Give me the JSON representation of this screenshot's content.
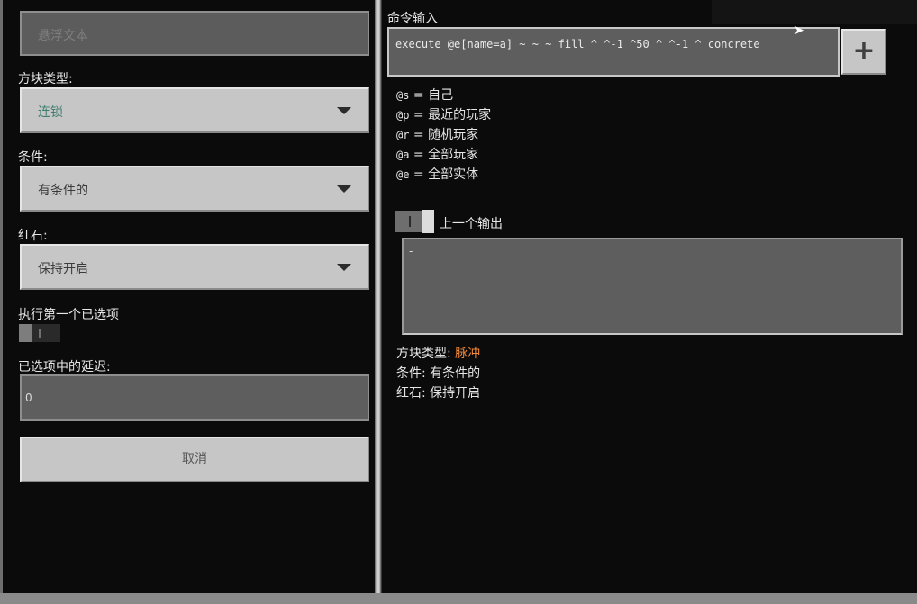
{
  "left_panel": {
    "hover_text_placeholder": "悬浮文本",
    "block_type_label": "方块类型:",
    "block_type_value": "连锁",
    "condition_label": "条件:",
    "condition_value": "有条件的",
    "redstone_label": "红石:",
    "redstone_value": "保持开启",
    "execute_first_label": "执行第一个已选项",
    "delay_label": "已选项中的延迟:",
    "delay_value": "0",
    "cancel_label": "取消"
  },
  "right_panel": {
    "command_input_label": "命令输入",
    "command_value": "execute @e[name=a] ~ ~ ~ fill ^ ^-1 ^50 ^ ^-1 ^ concrete",
    "add_button_label": "+",
    "selectors": [
      {
        "code": "@s",
        "desc": "= 自己"
      },
      {
        "code": "@p",
        "desc": "= 最近的玩家"
      },
      {
        "code": "@r",
        "desc": "= 随机玩家"
      },
      {
        "code": "@a",
        "desc": "= 全部玩家"
      },
      {
        "code": "@e",
        "desc": "= 全部实体"
      }
    ],
    "previous_output_label": "上一个输出",
    "output_value": "-",
    "info": {
      "block_type_label": "方块类型:",
      "block_type_value": "脉冲",
      "condition_label": "条件:",
      "condition_value": "有条件的",
      "redstone_label": "红石:",
      "redstone_value": "保持开启"
    }
  },
  "colors": {
    "background": "#0b0b0b",
    "button_gray": "#c6c6c6",
    "field_gray": "#5e5e5e",
    "accent_orange": "#f08a3c",
    "chain_green": "#3f7e6e"
  }
}
